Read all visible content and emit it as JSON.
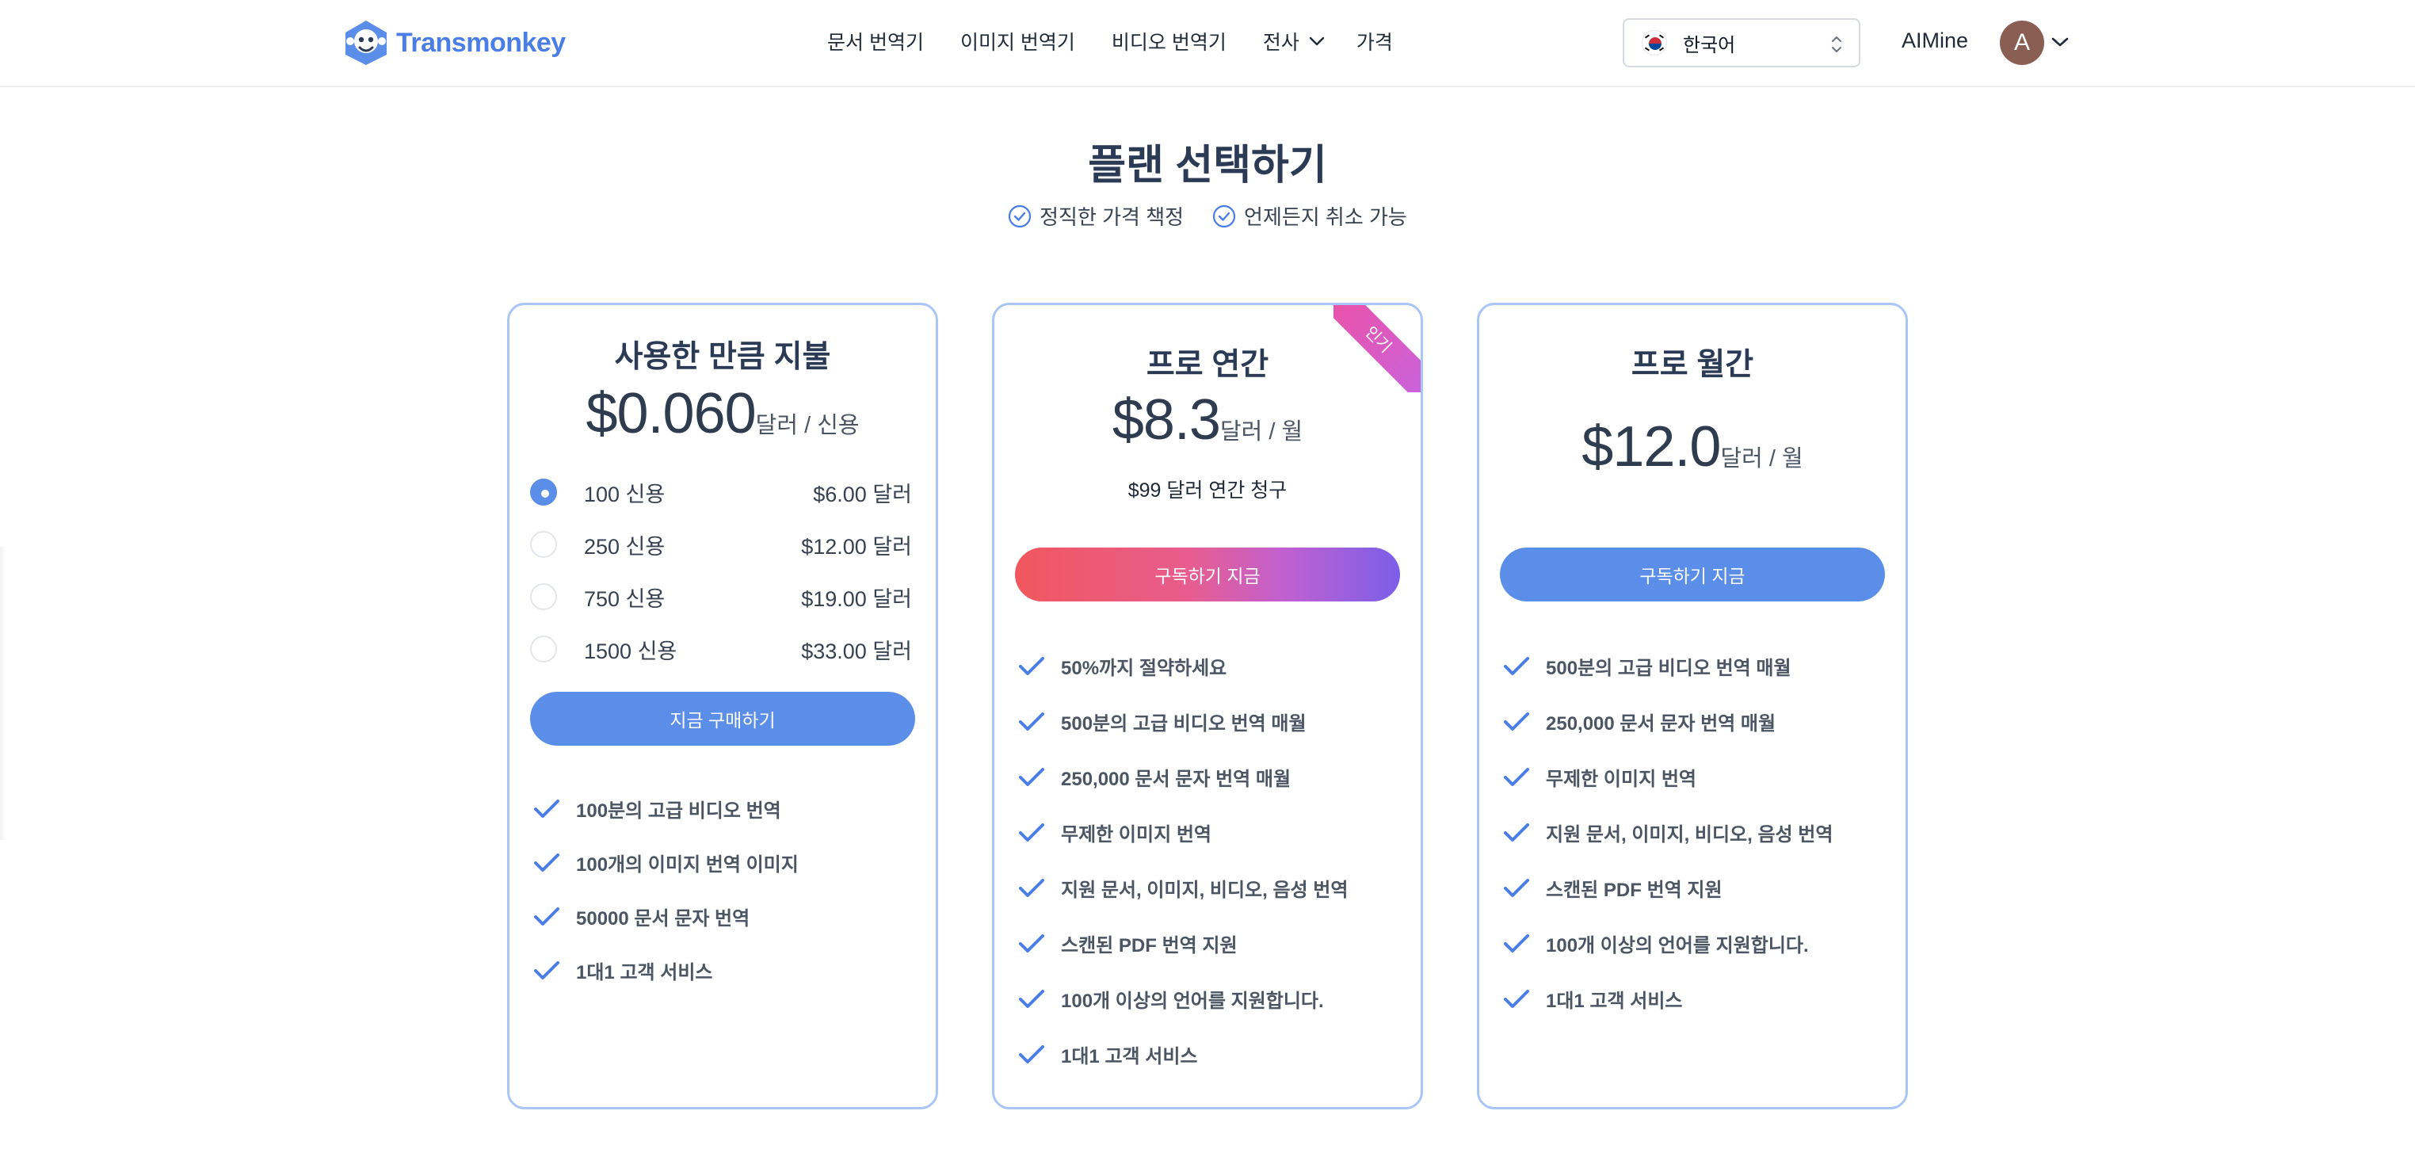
{
  "header": {
    "brand": "Transmonkey",
    "nav": [
      "문서 번역기",
      "이미지 번역기",
      "비디오 번역기",
      "전사",
      "가격"
    ],
    "language": "한국어",
    "username": "AIMine",
    "avatar_initial": "A",
    "icons": [
      "monkey-logo-icon",
      "chevron-down-icon",
      "korea-flag-icon",
      "updown-icon"
    ]
  },
  "page": {
    "title": "플랜 선택하기",
    "features": [
      "정직한 가격 책정",
      "언제든지 취소 가능"
    ]
  },
  "plans": {
    "payg": {
      "title": "사용한 만큼 지불",
      "price": "$0.060",
      "unit": "달러 / 신용",
      "options": [
        {
          "credits": "100 신용",
          "price": "$6.00 달러",
          "selected": true
        },
        {
          "credits": "250 신용",
          "price": "$12.00 달러",
          "selected": false
        },
        {
          "credits": "750 신용",
          "price": "$19.00 달러",
          "selected": false
        },
        {
          "credits": "1500 신용",
          "price": "$33.00 달러",
          "selected": false
        }
      ],
      "button": "지금 구매하기",
      "features": [
        "100분의 고급 비디오 번역",
        "100개의 이미지 번역 이미지",
        "50000 문서 문자 번역",
        "1대1 고객 서비스"
      ]
    },
    "annual": {
      "badge": "인기",
      "title": "프로 연간",
      "price": "$8.3",
      "unit": "달러 / 월",
      "billing": "$99 달러 연간 청구",
      "button": "구독하기 지금",
      "features": [
        "50%까지 절약하세요",
        "500분의 고급 비디오 번역 매월",
        "250,000 문서 문자 번역 매월",
        "무제한 이미지 번역",
        "지원 문서, 이미지, 비디오, 음성 번역",
        "스캔된 PDF 번역 지원",
        "100개 이상의 언어를 지원합니다.",
        "1대1 고객 서비스"
      ]
    },
    "monthly": {
      "title": "프로 월간",
      "price": "$12.0",
      "unit": "달러 / 월",
      "button": "구독하기 지금",
      "features": [
        "500분의 고급 비디오 번역 매월",
        "250,000 문서 문자 번역 매월",
        "무제한 이미지 번역",
        "지원 문서, 이미지, 비디오, 음성 번역",
        "스캔된 PDF 번역 지원",
        "100개 이상의 언어를 지원합니다.",
        "1대1 고객 서비스"
      ]
    }
  },
  "colors": {
    "accent": "#5b8ee8",
    "card_border": "#a9c6f6",
    "heading": "#2b3a55",
    "badge_gradient": [
      "#ef4fa0",
      "#c764e0"
    ],
    "button_gradient": [
      "#f0575d",
      "#7b5fe8"
    ]
  }
}
